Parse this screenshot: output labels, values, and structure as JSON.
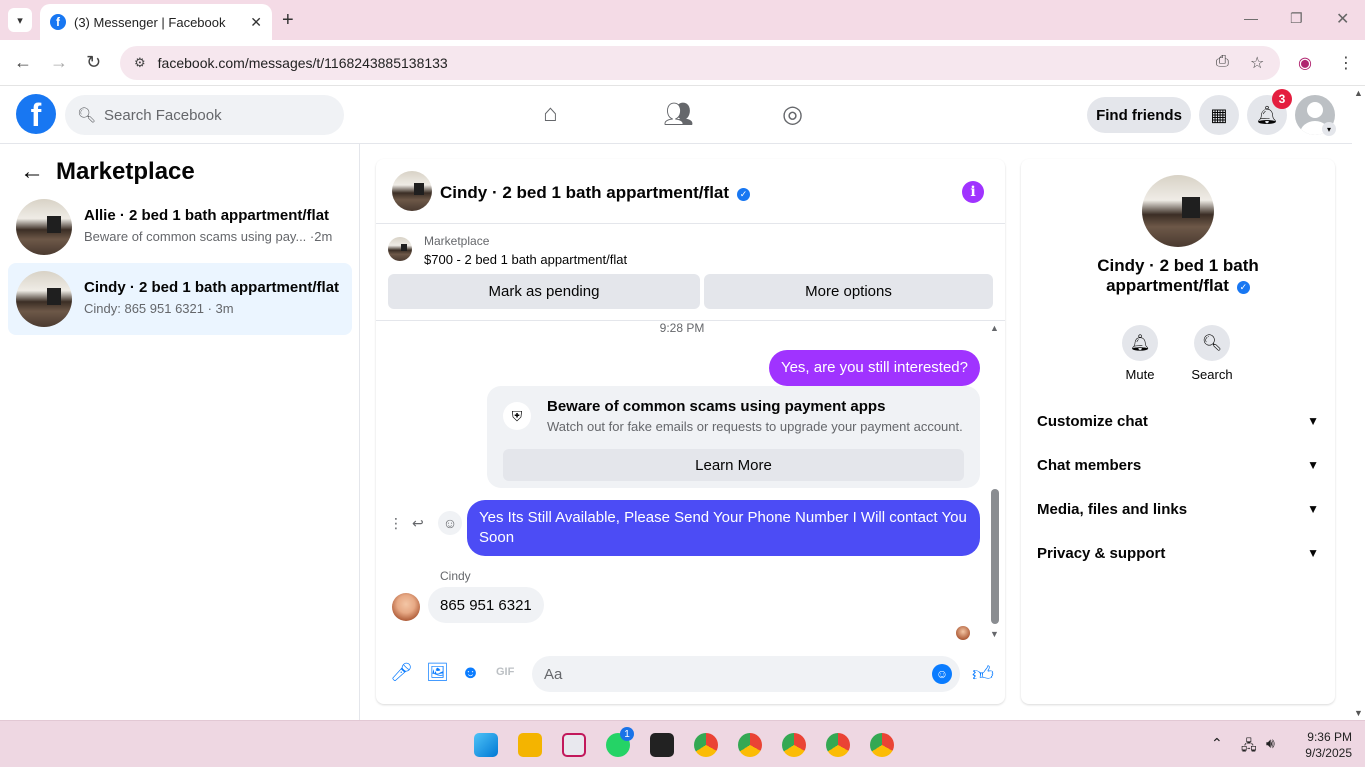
{
  "browser": {
    "tab_title": "(3) Messenger | Facebook",
    "url": "facebook.com/messages/t/1168243885138133"
  },
  "header": {
    "search_placeholder": "Search Facebook",
    "find_friends": "Find friends",
    "notification_count": "3"
  },
  "sidebar": {
    "title": "Marketplace",
    "conversations": [
      {
        "title": "Allie · 2 bed 1 bath appartment/flat",
        "subtitle": "Beware of common scams using pay... ·2m"
      },
      {
        "title": "Cindy · 2 bed 1 bath appartment/flat",
        "subtitle": "Cindy: 865 951 6321 · 3m"
      }
    ]
  },
  "chat": {
    "title": "Cindy · 2 bed 1 bath appartment/flat",
    "listing_label": "Marketplace",
    "listing_price": "$700 - 2 bed 1 bath appartment/flat",
    "mark_pending": "Mark as pending",
    "more_options": "More options",
    "timestamp": "9:28 PM",
    "msg1": "Yes, are you still interested?",
    "scam_title": "Beware of common scams using payment apps",
    "scam_desc": "Watch out for fake emails or requests to upgrade your payment account.",
    "learn_more": "Learn More",
    "msg2": "Yes Its Still Available, Please Send Your Phone Number I Will contact You Soon",
    "sender": "Cindy",
    "msg3": "865 951 6321",
    "composer_placeholder": "Aa"
  },
  "right": {
    "name": "Cindy · 2 bed 1 bath appartment/flat",
    "mute": "Mute",
    "search": "Search",
    "rows": [
      "Customize chat",
      "Chat members",
      "Media, files and links",
      "Privacy & support"
    ]
  },
  "taskbar": {
    "whatsapp_badge": "1",
    "time": "9:36 PM",
    "date": "9/3/2025"
  },
  "colors": {
    "fb_blue": "#1877f2",
    "purple_bubble": "#a033ff",
    "blue_bubble": "#4c4cf5",
    "messenger_blue": "#0a7cff"
  }
}
